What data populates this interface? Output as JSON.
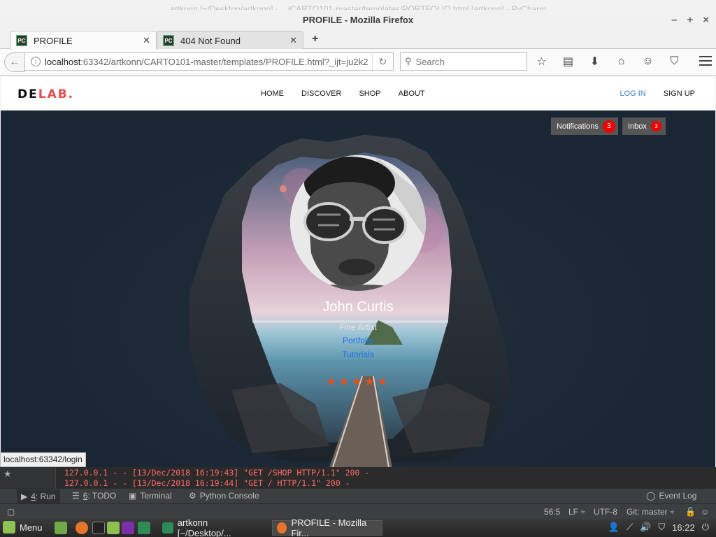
{
  "bg_window_title": "artkonn [~/Desktop/artkonn] - .../CARTO101-master/templates/PORTFOLIO.html [artkonn] - PyCharm",
  "window": {
    "title": "PROFILE - Mozilla Firefox",
    "controls": {
      "minimize": "–",
      "maximize": "+",
      "close": "×"
    }
  },
  "tabs": [
    {
      "label": "PROFILE",
      "favicon": "PC"
    },
    {
      "label": "404 Not Found",
      "favicon": "PC"
    }
  ],
  "newtab_label": "+",
  "urlbar": {
    "host": "localhost",
    "rest": ":63342/artkonn/CARTO101-master/templates/PROFILE.html?_ijt=ju2k2"
  },
  "searchbar": {
    "placeholder": "Search"
  },
  "toolbar_icons": [
    "bookmark-star-icon",
    "reading-list-icon",
    "download-icon",
    "home-icon",
    "hello-icon",
    "pocket-icon",
    "hamburger-menu-icon"
  ],
  "site": {
    "logo_de": "DE",
    "logo_lab": "LAB.",
    "nav": [
      "HOME",
      "DISCOVER",
      "SHOP",
      "ABOUT"
    ],
    "login": "LOG IN",
    "signup": "SIGN UP",
    "notifications_label": "Notifications",
    "notifications_count": "3",
    "inbox_label": "Inbox",
    "inbox_count": "3",
    "profile": {
      "name": "John Curtis",
      "role": "Fine Artist",
      "link_portfolio": "Portfolio",
      "link_tutorials": "Tutorials",
      "rating": 5,
      "stars": "★★★★★"
    },
    "accent_color": "#e84d4d"
  },
  "status_url": "localhost:63342/login",
  "pycharm": {
    "log_lines": [
      "127.0.0.1 - - [13/Dec/2018 16:19:43] \"GET /SHOP HTTP/1.1\" 200 -",
      "127.0.0.1 - - [13/Dec/2018 16:19:44] \"GET / HTTP/1.1\" 200 -"
    ],
    "tools": [
      {
        "num": "4",
        "label": ": Run"
      },
      {
        "num": "6",
        "label": ": TODO"
      },
      {
        "num": "",
        "label": "Terminal"
      },
      {
        "num": "",
        "label": "Python Console"
      }
    ],
    "event_log": "Event Log",
    "status": {
      "position": "56:5",
      "line_sep": "LF ÷",
      "encoding": "UTF-8",
      "git": "Git: master ÷"
    }
  },
  "taskbar": {
    "menu": "Menu",
    "tasks": [
      {
        "label": "artkonn [~/Desktop/..."
      },
      {
        "label": "PROFILE - Mozilla Fir..."
      }
    ],
    "clock": "16:22"
  }
}
